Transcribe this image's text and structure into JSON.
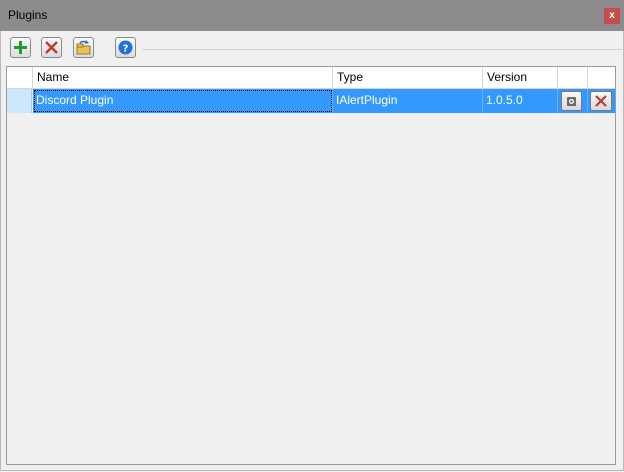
{
  "window": {
    "title": "Plugins",
    "close_glyph": "x"
  },
  "toolbar": {
    "buttons": [
      {
        "name": "add-plugin-button",
        "icon": "plus-icon"
      },
      {
        "name": "remove-plugin-button",
        "icon": "x-icon"
      },
      {
        "name": "reload-plugin-button",
        "icon": "folder-refresh-icon"
      },
      {
        "name": "help-button",
        "icon": "question-circle-icon"
      }
    ]
  },
  "grid": {
    "columns": [
      "Name",
      "Type",
      "Version",
      "",
      ""
    ],
    "rows": [
      {
        "name": "Discord Plugin",
        "type": "IAlertPlugin",
        "version": "1.0.5.0",
        "selected": true
      }
    ]
  },
  "colors": {
    "selection": "#3399ff",
    "titlebar": "#8c8c8c",
    "close": "#c64d4d",
    "add": "#1f9c2a",
    "remove": "#c0392b",
    "help": "#1e73d8"
  }
}
